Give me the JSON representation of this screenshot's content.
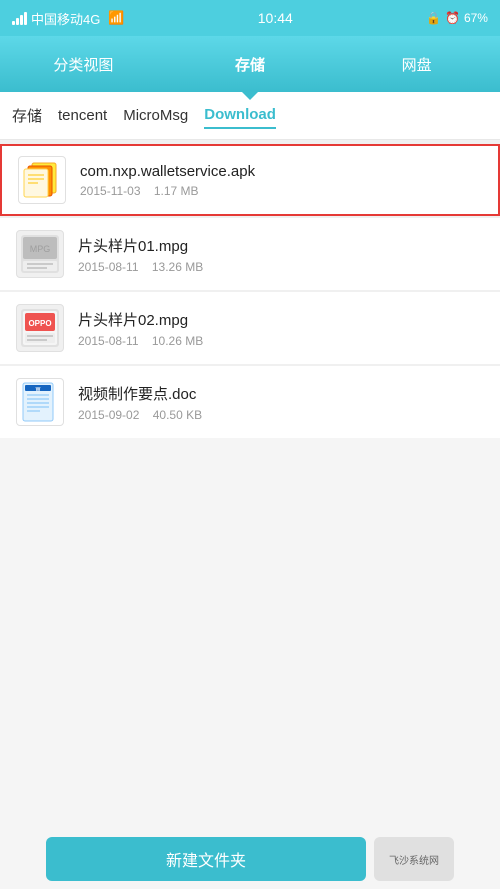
{
  "statusBar": {
    "carrier": "中国移动4G",
    "time": "10:44",
    "battery": "67%",
    "icons": [
      "signal",
      "wifi",
      "lock",
      "alarm",
      "battery"
    ]
  },
  "topNav": {
    "items": [
      {
        "label": "分类视图",
        "active": false
      },
      {
        "label": "存储",
        "active": true
      },
      {
        "label": "网盘",
        "active": false
      }
    ]
  },
  "breadcrumbs": [
    {
      "label": "存储",
      "active": false
    },
    {
      "label": "tencent",
      "active": false
    },
    {
      "label": "MicroMsg",
      "active": false
    },
    {
      "label": "Download",
      "active": true
    }
  ],
  "files": [
    {
      "name": "com.nxp.walletservice.apk",
      "date": "2015-11-03",
      "size": "1.17 MB",
      "type": "apk",
      "highlighted": true
    },
    {
      "name": "片头样片01.mpg",
      "date": "2015-08-11",
      "size": "13.26 MB",
      "type": "mpg",
      "highlighted": false
    },
    {
      "name": "片头样片02.mpg",
      "date": "2015-08-11",
      "size": "10.26 MB",
      "type": "mpg",
      "highlighted": false
    },
    {
      "name": "视频制作要点.doc",
      "date": "2015-09-02",
      "size": "40.50 KB",
      "type": "doc",
      "highlighted": false
    }
  ],
  "bottomBar": {
    "newFolderLabel": "新建文件夹",
    "watermark": "飞沙系统网"
  }
}
